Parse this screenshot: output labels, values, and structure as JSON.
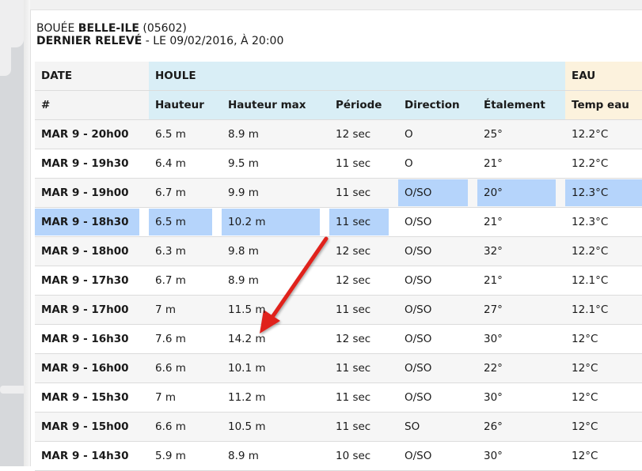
{
  "header": {
    "prefix": "BOUÉE",
    "buoy_name": "BELLE-ILE",
    "buoy_id": "(05602)",
    "last_label": "DERNIER RELEVÉ",
    "last_value": "- LE 09/02/2016, À 20:00"
  },
  "groups": {
    "date": "DATE",
    "houle": "HOULE",
    "eau": "EAU"
  },
  "columns": [
    "#",
    "Hauteur",
    "Hauteur max",
    "Période",
    "Direction",
    "Étalement",
    "Temp eau"
  ],
  "rows": [
    [
      "MAR 9 - 20h00",
      "6.5 m",
      "8.9 m",
      "12 sec",
      "O",
      "25°",
      "12.2°C"
    ],
    [
      "MAR 9 - 19h30",
      "6.4 m",
      "9.5 m",
      "11 sec",
      "O",
      "21°",
      "12.2°C"
    ],
    [
      "MAR 9 - 19h00",
      "6.7 m",
      "9.9 m",
      "11 sec",
      "O/SO",
      "20°",
      "12.3°C"
    ],
    [
      "MAR 9 - 18h30",
      "6.5 m",
      "10.2 m",
      "11 sec",
      "O/SO",
      "21°",
      "12.3°C"
    ],
    [
      "MAR 9 - 18h00",
      "6.3 m",
      "9.8 m",
      "12 sec",
      "O/SO",
      "32°",
      "12.2°C"
    ],
    [
      "MAR 9 - 17h30",
      "6.7 m",
      "8.9 m",
      "12 sec",
      "O/SO",
      "21°",
      "12.1°C"
    ],
    [
      "MAR 9 - 17h00",
      "7 m",
      "11.5 m",
      "11 sec",
      "O/SO",
      "27°",
      "12.1°C"
    ],
    [
      "MAR 9 - 16h30",
      "7.6 m",
      "14.2 m",
      "12 sec",
      "O/SO",
      "30°",
      "12°C"
    ],
    [
      "MAR 9 - 16h00",
      "6.6 m",
      "10.1 m",
      "11 sec",
      "O/SO",
      "22°",
      "12°C"
    ],
    [
      "MAR 9 - 15h30",
      "7 m",
      "11.2 m",
      "11 sec",
      "O/SO",
      "30°",
      "12°C"
    ],
    [
      "MAR 9 - 15h00",
      "6.6 m",
      "10.5 m",
      "11 sec",
      "SO",
      "26°",
      "12°C"
    ],
    [
      "MAR 9 - 14h30",
      "5.9 m",
      "8.9 m",
      "10 sec",
      "O/SO",
      "30°",
      "12°C"
    ]
  ],
  "selection": {
    "row_19h00_cols": [
      4,
      5,
      6
    ],
    "row_18h30_cols": [
      0,
      1,
      2,
      3
    ]
  },
  "colors": {
    "houle_header": "#d9eef6",
    "eau_header": "#fcf2dd",
    "selection": "#b5d4fb",
    "arrow": "#e0201b"
  }
}
